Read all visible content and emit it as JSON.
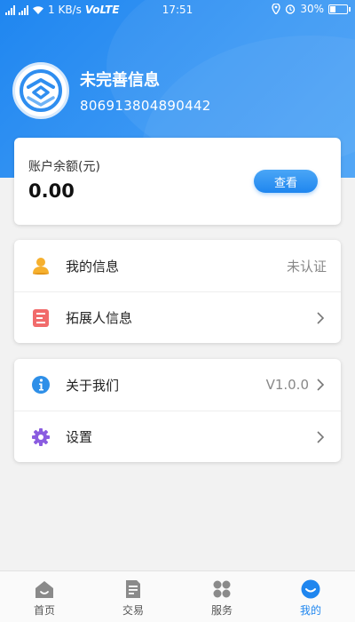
{
  "status_bar": {
    "network_speed": "1 KB/s",
    "network_type": "VoLTE",
    "time": "17:51",
    "battery": "30%",
    "battery_level": 0.3
  },
  "profile": {
    "name": "未完善信息",
    "account_id": "806913804890442"
  },
  "balance": {
    "label": "账户余额(元)",
    "value": "0.00",
    "view_button": "查看"
  },
  "menu_group_1": [
    {
      "icon": "user-icon",
      "label": "我的信息",
      "value": "未认证"
    },
    {
      "icon": "list-icon",
      "label": "拓展人信息",
      "value": ""
    }
  ],
  "menu_group_2": [
    {
      "icon": "info-icon",
      "label": "关于我们",
      "value": "V1.0.0"
    },
    {
      "icon": "gear-icon",
      "label": "设置",
      "value": ""
    }
  ],
  "tabbar": [
    {
      "icon": "home-icon",
      "label": "首页"
    },
    {
      "icon": "document-icon",
      "label": "交易"
    },
    {
      "icon": "grid-icon",
      "label": "服务"
    },
    {
      "icon": "profile-icon",
      "label": "我的"
    }
  ],
  "colors": {
    "accent": "#1f86ef",
    "header_gradient_start": "#1f86f0",
    "header_gradient_end": "#4aa3f6",
    "background": "#f2f2f2"
  }
}
